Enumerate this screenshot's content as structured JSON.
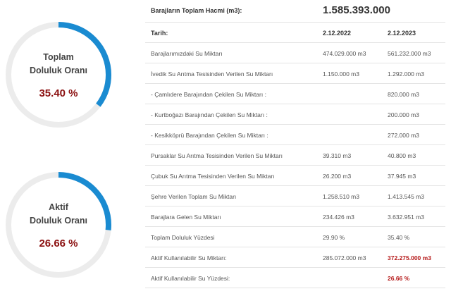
{
  "colors": {
    "arc": "#1a8bd1",
    "track": "#ececec",
    "value": "#8b1010",
    "highlight": "#b51818"
  },
  "gauges": [
    {
      "title_line1": "Toplam",
      "title_line2": "Doluluk Oranı",
      "value_text": "35.40 %",
      "percent": 35.4
    },
    {
      "title_line1": "Aktif",
      "title_line2": "Doluluk Oranı",
      "value_text": "26.66 %",
      "percent": 26.66
    }
  ],
  "table": {
    "total_label": "Barajların Toplam Hacmi (m3):",
    "total_value": "1.585.393.000",
    "header": {
      "label": "Tarih:",
      "col1": "2.12.2022",
      "col2": "2.12.2023"
    },
    "rows": [
      {
        "label": "Barajlarımızdaki Su Miktarı",
        "v1": "474.029.000 m3",
        "v2": "561.232.000 m3"
      },
      {
        "label": "İvedik Su Arıtma Tesisinden Verilen Su Miktarı",
        "v1": "1.150.000 m3",
        "v2": "1.292.000 m3"
      },
      {
        "label": "- Çamlıdere Barajından Çekilen Su Miktarı :",
        "v1": "",
        "v2": "820.000 m3"
      },
      {
        "label": "- Kurtboğazı Barajından Çekilen Su Miktarı :",
        "v1": "",
        "v2": "200.000 m3"
      },
      {
        "label": "- Kesikköprü Barajından Çekilen Su Miktarı :",
        "v1": "",
        "v2": "272.000 m3"
      },
      {
        "label": "Pursaklar Su Arıtma Tesisinden Verilen Su Miktarı",
        "v1": "39.310 m3",
        "v2": "40.800 m3"
      },
      {
        "label": "Çubuk Su Arıtma Tesisinden Verilen Su Miktarı",
        "v1": "26.200 m3",
        "v2": "37.945 m3"
      },
      {
        "label": "Şehre Verilen Toplam Su Miktarı",
        "v1": "1.258.510 m3",
        "v2": "1.413.545 m3"
      },
      {
        "label": "Barajlara Gelen Su Miktarı",
        "v1": "234.426 m3",
        "v2": "3.632.951 m3"
      },
      {
        "label": "Toplam Doluluk Yüzdesi",
        "v1": "29.90 %",
        "v2": "35.40 %"
      },
      {
        "label": "Aktif Kullanılabilir Su Miktarı:",
        "v1": "285.072.000 m3",
        "v2": "372.275.000 m3"
      },
      {
        "label": "Aktif Kullanılabilir Su Yüzdesi:",
        "v1": "",
        "v2": "26.66 %"
      }
    ]
  }
}
